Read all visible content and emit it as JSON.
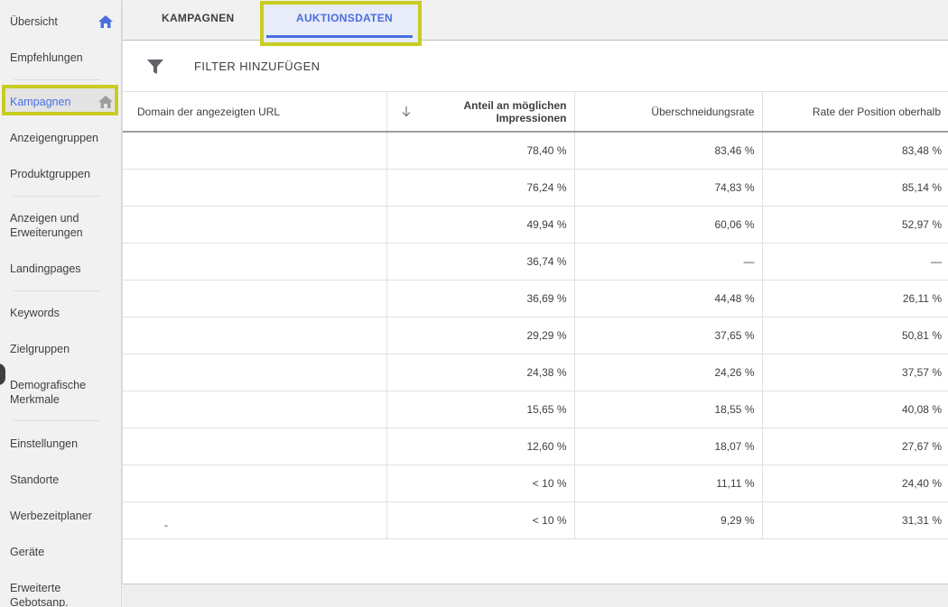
{
  "sidebar": {
    "items": [
      {
        "label": "Übersicht",
        "icon": "home-icon"
      },
      {
        "label": "Empfehlungen"
      },
      {
        "label": "Kampagnen",
        "icon": "home-icon",
        "active": true
      },
      {
        "label": "Anzeigengruppen"
      },
      {
        "label": "Produktgruppen"
      },
      {
        "label": "Anzeigen und Erweiterungen"
      },
      {
        "label": "Landingpages"
      },
      {
        "label": "Keywords"
      },
      {
        "label": "Zielgruppen"
      },
      {
        "label": "Demografische Merkmale"
      },
      {
        "label": "Einstellungen"
      },
      {
        "label": "Standorte"
      },
      {
        "label": "Werbezeitplaner"
      },
      {
        "label": "Geräte"
      },
      {
        "label": "Erweiterte Gebotsanp."
      }
    ]
  },
  "tabs": [
    {
      "label": "KAMPAGNEN"
    },
    {
      "label": "AUKTIONSDATEN",
      "selected": true
    }
  ],
  "filter": {
    "label": "FILTER HINZUFÜGEN",
    "icon": "filter-icon"
  },
  "table": {
    "columns": [
      "Domain der angezeigten URL",
      "Anteil an möglichen Impressionen",
      "Überschneidungsrate",
      "Rate der Position oberhalb"
    ],
    "sort_icon": "arrow-down-icon",
    "rows": [
      [
        "",
        "78,40 %",
        "83,46 %",
        "83,48 %"
      ],
      [
        "",
        "76,24 %",
        "74,83 %",
        "85,14 %"
      ],
      [
        "",
        "49,94 %",
        "60,06 %",
        "52,97 %"
      ],
      [
        "",
        "36,74 %",
        "—",
        "—"
      ],
      [
        "",
        "36,69 %",
        "44,48 %",
        "26,11 %"
      ],
      [
        "",
        "29,29 %",
        "37,65 %",
        "50,81 %"
      ],
      [
        "",
        "24,38 %",
        "24,26 %",
        "37,57 %"
      ],
      [
        "",
        "15,65 %",
        "18,55 %",
        "40,08 %"
      ],
      [
        "",
        "12,60 %",
        "18,07 %",
        "27,67 %"
      ],
      [
        "",
        "< 10 %",
        "11,11 %",
        "24,40 %"
      ],
      [
        "-",
        "< 10 %",
        "9,29 %",
        "31,31 %"
      ]
    ]
  },
  "colors": {
    "accent": "#4a6ee0",
    "highlight": "#c9cc22"
  }
}
